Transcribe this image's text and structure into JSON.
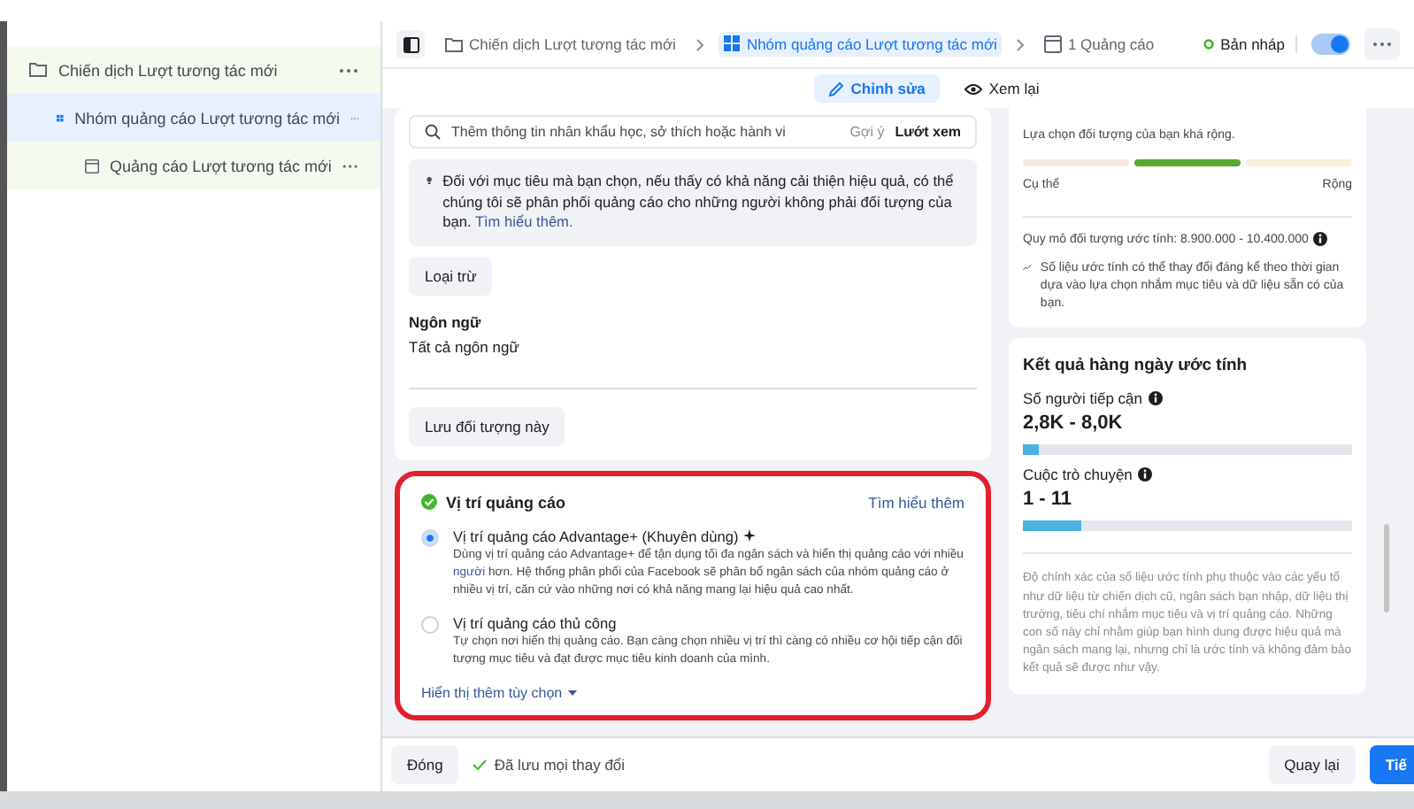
{
  "sidebar": {
    "items": [
      {
        "label": "Chiến dịch Lượt tương tác mới",
        "kind": "campaign",
        "selected": false,
        "children": [
          {
            "label": "Nhóm quảng cáo Lượt tương tác mới",
            "kind": "adset",
            "selected": true,
            "children": [
              {
                "label": "Quảng cáo Lượt tương tác mới",
                "kind": "ad",
                "selected": false
              }
            ]
          }
        ]
      }
    ]
  },
  "breadcrumb": [
    {
      "label": "Chiến dịch Lượt tương tác mới",
      "kind": "campaign",
      "selected": false
    },
    {
      "label": "Nhóm quảng cáo Lượt tương tác mới",
      "kind": "adset",
      "selected": true
    },
    {
      "label": "1 Quảng cáo",
      "kind": "ad",
      "selected": false
    }
  ],
  "status": {
    "label": "Bản nháp",
    "on": true
  },
  "tabs": [
    {
      "label": "Chỉnh sửa",
      "kind": "edit",
      "selected": true
    },
    {
      "label": "Xem lại",
      "kind": "review",
      "selected": false
    }
  ],
  "audience": {
    "search": {
      "placeholder": "Thêm thông tin nhân khẩu học, sở thích hoặc hành vi",
      "suggest": "Gợi ý",
      "browse": "Lướt xem"
    },
    "notice": {
      "text": "Đối với mục tiêu mà bạn chọn, nếu thấy có khả năng cải thiện hiệu quả, có thể chúng tôi sẽ phân phối quảng cáo cho những người không phải đối tượng của bạn.",
      "link": "Tìm hiểu thêm."
    },
    "exclude_button": "Loại trừ",
    "language_label": "Ngôn ngữ",
    "language_value": "Tất cả ngôn ngữ",
    "save_button": "Lưu đối tượng này"
  },
  "placement": {
    "title": "Vị trí quảng cáo",
    "complete": true,
    "highlighted": true,
    "learn_more": "Tìm hiểu thêm",
    "options": [
      {
        "title": "Vị trí quảng cáo Advantage+ (Khuyên dùng)",
        "kind": "advantage",
        "selected": true,
        "description_before": "Dùng vị trí quảng cáo Advantage+ để tận dụng tối đa ngân sách và hiển thị quảng cáo với nhiều",
        "description_link": "người",
        "description_after": "hơn. Hệ thống phân phối của Facebook sẽ phân bổ ngân sách của nhóm quảng cáo ở nhiều vị trí, căn cứ vào những nơi có khả năng mang lại hiệu quả cao nhất."
      },
      {
        "title": "Vị trí quảng cáo thủ công",
        "kind": "manual",
        "selected": false,
        "description_before": "Tự chọn nơi hiển thị quảng cáo. Bạn càng chọn nhiều vị trí thì càng có nhiều cơ hội tiếp cận đối tượng mục tiêu và đạt được mục tiêu kinh doanh của mình."
      }
    ],
    "show_more": "Hiển thị thêm tùy chọn"
  },
  "audience_definition": {
    "summary": "Lựa chọn đối tượng của bạn khá rộng.",
    "segments": [
      {
        "kind": "narrow",
        "selected": false
      },
      {
        "kind": "fit",
        "selected": true
      },
      {
        "kind": "broad",
        "selected": false
      }
    ],
    "left_label": "Cụ thể",
    "right_label": "Rộng",
    "size": "Quy mô đối tượng ước tính: 8.900.000 - 10.400.000",
    "note": "Số liệu ước tính có thể thay đổi đáng kể theo thời gian dựa vào lựa chọn nhắm mục tiêu và dữ liệu sẵn có của bạn."
  },
  "daily_results": {
    "title": "Kết quả hàng ngày ước tính",
    "metrics": [
      {
        "label": "Số người tiếp cận",
        "value": "2,8K - 8,0K",
        "level": 0.05
      },
      {
        "label": "Cuộc trò chuyện",
        "value": "1 - 11",
        "level": 0.18
      }
    ],
    "disclaimer": "Độ chính xác của số liệu ước tính phụ thuộc vào các yếu tố như dữ liệu từ chiến dịch cũ, ngân sách bạn nhập, dữ liệu thị trường, tiêu chí nhắm mục tiêu và vị trí quảng cáo. Những con số này chỉ nhằm giúp bạn hình dung được hiệu quả mà ngân sách mang lại, nhưng chỉ là ước tính và không đảm bảo kết quả sẽ được như vậy."
  },
  "footer": {
    "close": "Đóng",
    "saved": "Đã lưu mọi thay đổi",
    "back": "Quay lại",
    "next": "Tiế"
  }
}
